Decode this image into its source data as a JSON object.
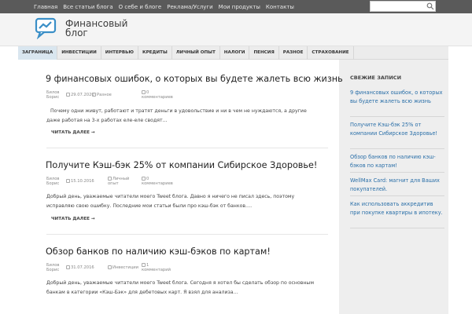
{
  "topnav": [
    "Главная",
    "Все статьи блога",
    "О себе и блоге",
    "Реклама/Услуги",
    "Мои продукты",
    "Контакты"
  ],
  "logo": {
    "line1": "Финансовый",
    "line2": "блог"
  },
  "nav": [
    "ЗАГРАНИЦА",
    "ИНВЕСТИЦИИ",
    "ИНТЕРВЬЮ",
    "КРЕДИТЫ",
    "ЛИЧНЫЙ ОПЫТ",
    "НАЛОГИ",
    "ПЕНСИЯ",
    "РАЗНОЕ",
    "СТРАХОВАНИЕ"
  ],
  "posts": [
    {
      "title": "9 финансовых ошибок, о которых вы будете жалеть всю жизнь",
      "author": "Билов Борис",
      "date": "29.07.2020",
      "category": "Разное",
      "comments": "0",
      "comments_label": "комментариев",
      "excerpt": "Почему одни живут, работают и тратят деньги в удовольствие и ни в чем не нуждаются, а другие даже работая на 3-х работах еле-еле сводят…",
      "readmore": "ЧИТАТЬ ДАЛЕЕ →"
    },
    {
      "title": "Получите Кэш-бэк 25% от компании Сибирское Здоровье!",
      "author": "Билов Борис",
      "date": "15.10.2016",
      "category": "Личный опыт",
      "comments": "0",
      "comments_label": "комментариев",
      "excerpt": "Добрый день, уважаемые читатели моего Tweet блога. Давно я ничего не писал здесь, поэтому исправляю свою ошибку. Последние мои статьи были про кэш-бэк от банков.…",
      "readmore": "ЧИТАТЬ ДАЛЕЕ →"
    },
    {
      "title": "Обзор банков по наличию кэш-бэков по картам!",
      "author": "Билов Борис",
      "date": "31.07.2016",
      "category": "Инвестиции",
      "comments": "1",
      "comments_label": "комментарий",
      "excerpt": "Добрый день, уважаемые читатели моего Tweet блога. Сегодня я хотел бы сделать обзор по основным банкам в категории «Кэш-Бэк» для дебетовых карт. Я взял для анализа…",
      "readmore": ""
    }
  ],
  "sidebar": {
    "heading": "СВЕЖИЕ ЗАПИСИ",
    "links": [
      "9 финансовых ошибок, о которых вы будете жалеть всю жизнь",
      "Получите Кэш-бэк 25% от компании Сибирское Здоровье!",
      "Обзор банков по наличию кэш-бэков по картам!",
      "WellMax Card: магнит для Ваших покупателей.",
      "Как использовать аккредитив при покупке квартиры в ипотеку."
    ]
  },
  "colors": {
    "topbar": "#5a5a5a",
    "link": "#2a6fa8",
    "logo": "#3a8fc7"
  }
}
